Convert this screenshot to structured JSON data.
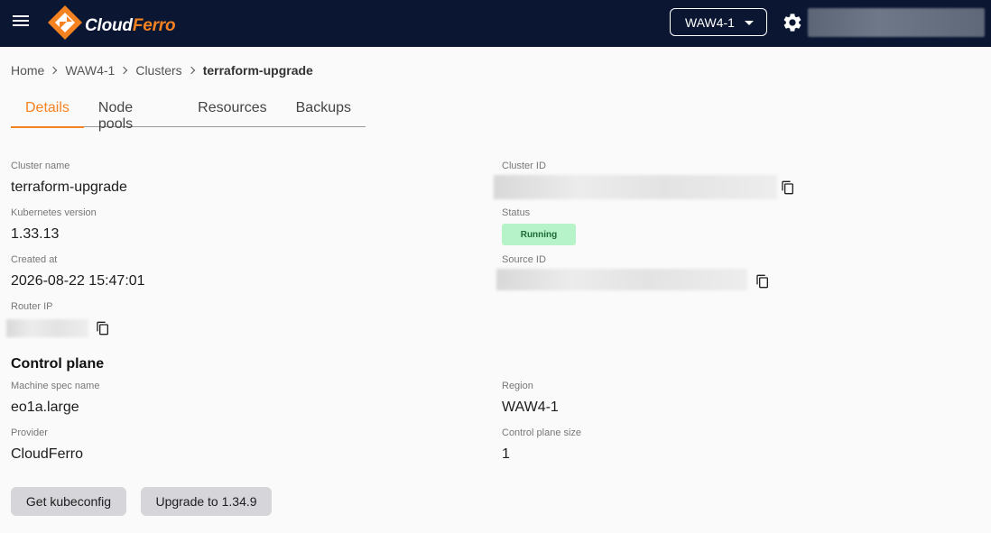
{
  "header": {
    "brand_left": "Cloud",
    "brand_right": "Ferro",
    "region_selected": "WAW4-1",
    "colors": {
      "topbar": "#0b1633",
      "accent": "#f58220"
    }
  },
  "breadcrumb": {
    "items": [
      "Home",
      "WAW4-1",
      "Clusters"
    ],
    "current": "terraform-upgrade"
  },
  "tabs": [
    {
      "label": "Details",
      "active": true
    },
    {
      "label": "Node pools",
      "active": false
    },
    {
      "label": "Resources",
      "active": false
    },
    {
      "label": "Backups",
      "active": false
    }
  ],
  "details": {
    "cluster_name": {
      "label": "Cluster name",
      "value": "terraform-upgrade"
    },
    "cluster_id": {
      "label": "Cluster ID"
    },
    "kubernetes_version": {
      "label": "Kubernetes version",
      "value": "1.33.13"
    },
    "status": {
      "label": "Status",
      "value": "Running"
    },
    "created_at": {
      "label": "Created at",
      "value": "2026-08-22 15:47:01"
    },
    "source_id": {
      "label": "Source ID"
    },
    "router_ip": {
      "label": "Router IP"
    }
  },
  "control_plane": {
    "title": "Control plane",
    "machine_spec": {
      "label": "Machine spec name",
      "value": "eo1a.large"
    },
    "region": {
      "label": "Region",
      "value": "WAW4-1"
    },
    "provider": {
      "label": "Provider",
      "value": "CloudFerro"
    },
    "size": {
      "label": "Control plane size",
      "value": "1"
    }
  },
  "actions": {
    "get_kubeconfig": "Get kubeconfig",
    "upgrade": "Upgrade to 1.34.9"
  },
  "icons": {
    "menu": "menu-icon",
    "settings": "gear-icon",
    "copy": "copy-icon",
    "dropdown": "caret-down-icon"
  }
}
